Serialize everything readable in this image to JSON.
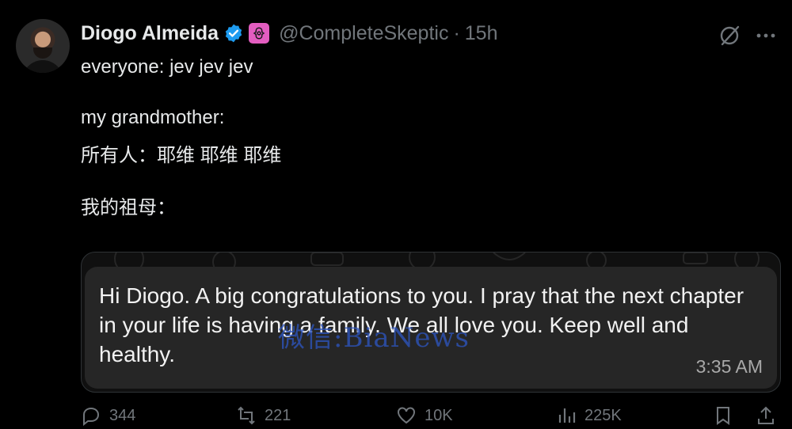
{
  "author": {
    "name": "Diogo Almeida",
    "handle": "@CompleteSkeptic",
    "separator": "·",
    "time": "15h"
  },
  "tweet": {
    "line1": "everyone: jev jev jev",
    "line2": "my grandmother:",
    "line3": "所有人：耶维 耶维 耶维",
    "line4": "我的祖母："
  },
  "media": {
    "message": "Hi Diogo. A big congratulations to you.  I pray that the next chapter in your life is having a family. We all love you. Keep well and healthy.",
    "time": "3:35 AM",
    "watermark": "微信:BiaNews"
  },
  "actions": {
    "replies": "344",
    "reposts": "221",
    "likes": "10K",
    "views": "225K"
  },
  "icons": [
    "verified-icon",
    "affiliate-badge-icon",
    "grok-icon",
    "more-icon",
    "reply-icon",
    "repost-icon",
    "like-icon",
    "views-icon",
    "bookmark-icon",
    "share-icon"
  ],
  "colors": {
    "background": "#000000",
    "text": "#e7e9ea",
    "secondary": "#71767b",
    "verified": "#1d9bf0",
    "affiliate": "#e35dc0"
  }
}
